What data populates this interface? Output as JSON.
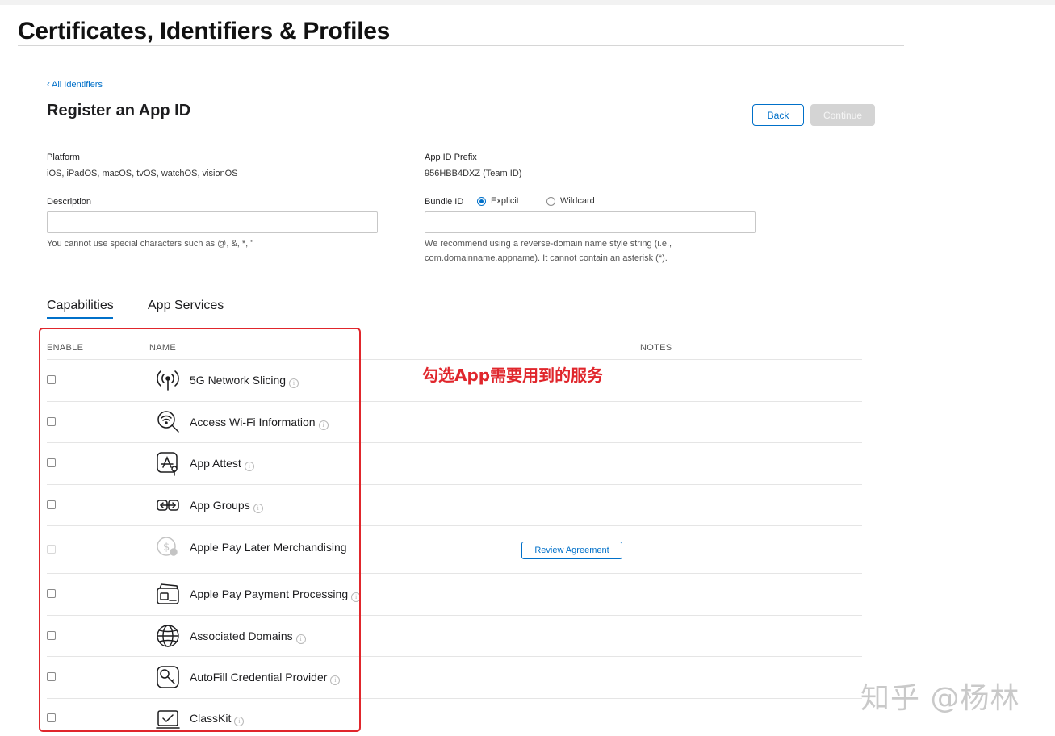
{
  "page": {
    "header": "Certificates, Identifiers & Profiles"
  },
  "nav": {
    "back_link": "All Identifiers"
  },
  "form": {
    "title": "Register an App ID",
    "back_button": "Back",
    "continue_button": "Continue",
    "platform_label": "Platform",
    "platform_value": "iOS, iPadOS, macOS, tvOS, watchOS, visionOS",
    "prefix_label": "App ID Prefix",
    "prefix_value": "956HBB4DXZ (Team ID)",
    "description_label": "Description",
    "description_value": "",
    "description_hint": "You cannot use special characters such as @, &, *, \"",
    "bundle_label": "Bundle ID",
    "bundle_options": [
      "Explicit",
      "Wildcard"
    ],
    "bundle_selected": "Explicit",
    "bundle_value": "",
    "bundle_hint_1": "We recommend using a reverse-domain name style string (i.e.,",
    "bundle_hint_2": "com.domainname.appname). It cannot contain an asterisk (*)."
  },
  "tabs": [
    "Capabilities",
    "App Services"
  ],
  "active_tab": "Capabilities",
  "table": {
    "headers": {
      "enable": "ENABLE",
      "name": "NAME",
      "notes": "NOTES"
    },
    "rows": [
      {
        "name": "5G Network Slicing",
        "icon": "antenna-icon",
        "enabled": true,
        "info": true
      },
      {
        "name": "Access Wi-Fi Information",
        "icon": "wifi-search-icon",
        "enabled": true,
        "info": true
      },
      {
        "name": "App Attest",
        "icon": "app-attest-icon",
        "enabled": true,
        "info": true
      },
      {
        "name": "App Groups",
        "icon": "app-groups-icon",
        "enabled": true,
        "info": true
      },
      {
        "name": "Apple Pay Later Merchandising",
        "icon": "pay-later-icon",
        "enabled": false,
        "info": false,
        "note_button": "Review Agreement"
      },
      {
        "name": "Apple Pay Payment Processing",
        "icon": "card-icon",
        "enabled": true,
        "info": true
      },
      {
        "name": "Associated Domains",
        "icon": "globe-icon",
        "enabled": true,
        "info": true
      },
      {
        "name": "AutoFill Credential Provider",
        "icon": "key-icon",
        "enabled": true,
        "info": true
      },
      {
        "name": "ClassKit",
        "icon": "classkit-icon",
        "enabled": true,
        "info": true
      }
    ]
  },
  "annotation": "勾选App需要用到的服务",
  "watermark": "知乎 @杨林",
  "colors": {
    "accent": "#0070c9",
    "annotation_red": "#e0262c",
    "disabled_button": "#d4d4d4"
  }
}
